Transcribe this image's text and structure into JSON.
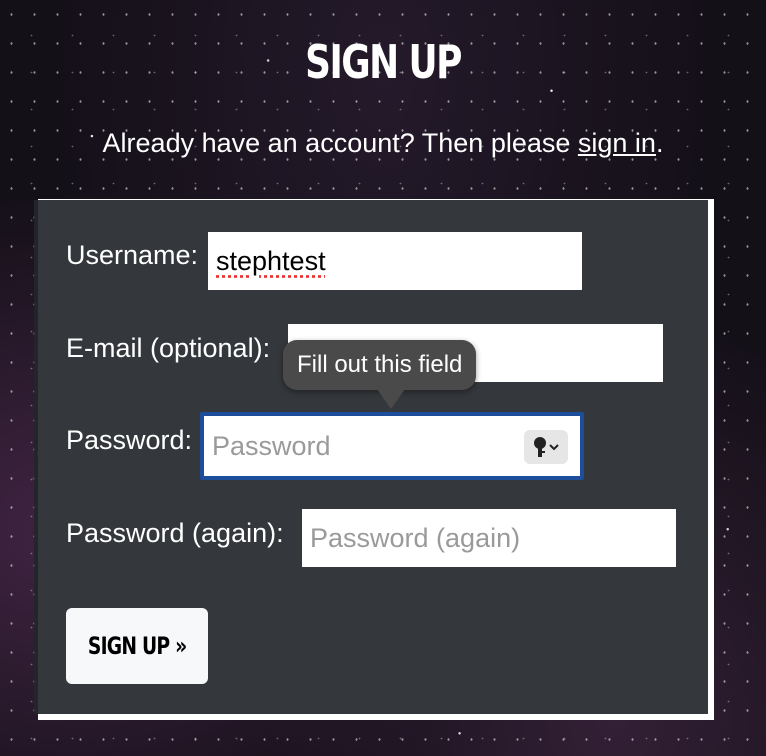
{
  "page": {
    "title": "SIGN UP",
    "subtitle_text": "Already have an account? Then please ",
    "subtitle_link": "sign in",
    "subtitle_end": "."
  },
  "form": {
    "username_label": "Username:",
    "username_value": "stephtest",
    "email_label": "E-mail (optional):",
    "email_value": "",
    "password_label": "Password:",
    "password_placeholder": "Password",
    "password_again_label": "Password (again):",
    "password_again_placeholder": "Password (again)",
    "submit_label": "SIGN UP »"
  },
  "tooltip": {
    "text": "Fill out this field"
  },
  "icons": {
    "password_manager": "key-icon"
  },
  "colors": {
    "focus_border": "#1d4e9c",
    "panel_bg": "#23262a",
    "tooltip_bg": "#4a4a4a"
  }
}
